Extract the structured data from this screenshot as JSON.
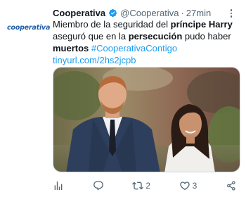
{
  "account": {
    "logo_text": "cooperativa",
    "display_name": "Cooperativa",
    "handle": "@Cooperativa",
    "separator": "·",
    "time": "27min"
  },
  "tweet": {
    "text_1": "Miembro de la seguridad del ",
    "bold_1": "príncipe Harry",
    "text_2": " aseguró que en la ",
    "bold_2": "persecución",
    "text_3": " pudo haber ",
    "bold_3": "muertos",
    "text_4": " ",
    "hashtag": "#CooperativaContigo",
    "text_5": " ",
    "link": "tinyurl.com/2hs2jcpb"
  },
  "actions": {
    "views_icon": "analytics-icon",
    "reply_icon": "reply-icon",
    "retweet_icon": "retweet-icon",
    "retweet_count": "2",
    "like_icon": "heart-icon",
    "like_count": "3",
    "share_icon": "share-icon"
  },
  "colors": {
    "brand_blue": "#1d9bf0",
    "logo_blue": "#1f5fa8",
    "muted_text": "#536471"
  }
}
